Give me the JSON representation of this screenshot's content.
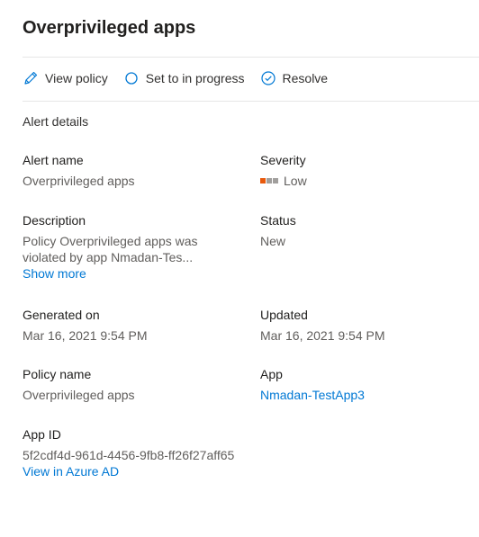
{
  "panel": {
    "title": "Overprivileged apps"
  },
  "toolbar": {
    "view_policy": "View policy",
    "set_in_progress": "Set to in progress",
    "resolve": "Resolve"
  },
  "details": {
    "section_title": "Alert details",
    "alert_name": {
      "label": "Alert name",
      "value": "Overprivileged apps"
    },
    "severity": {
      "label": "Severity",
      "value": "Low",
      "level": 1,
      "max_level": 3,
      "colors": {
        "active": "#e8590c",
        "inactive": "#a19f9d"
      }
    },
    "description": {
      "label": "Description",
      "line1": "Policy Overprivileged apps was",
      "line2": "violated by app Nmadan-Tes...",
      "show_more": "Show more"
    },
    "status": {
      "label": "Status",
      "value": "New"
    },
    "generated_on": {
      "label": "Generated on",
      "value": "Mar 16, 2021 9:54 PM"
    },
    "updated": {
      "label": "Updated",
      "value": "Mar 16, 2021 9:54 PM"
    },
    "policy_name": {
      "label": "Policy name",
      "value": "Overprivileged apps"
    },
    "app": {
      "label": "App",
      "value": "Nmadan-TestApp3"
    },
    "app_id": {
      "label": "App ID",
      "value": "5f2cdf4d-961d-4456-9fb8-ff26f27aff65",
      "link": "View in Azure AD"
    }
  },
  "colors": {
    "accent": "#0078d4",
    "label": "#201f1e",
    "value": "#605e5c"
  }
}
